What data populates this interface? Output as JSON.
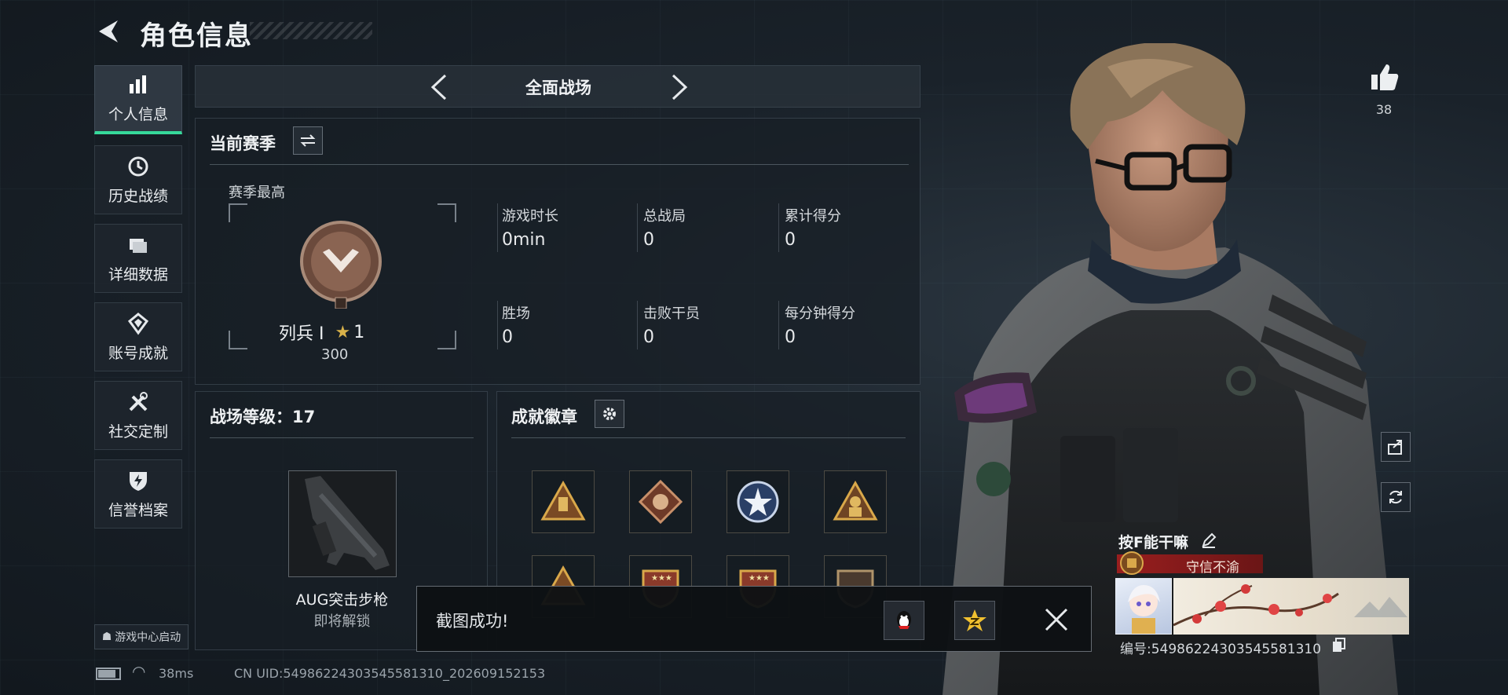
{
  "header": {
    "title": "角色信息"
  },
  "sidebar": {
    "items": [
      {
        "label": "个人信息",
        "icon": "bar-chart-icon",
        "active": true
      },
      {
        "label": "历史战绩",
        "icon": "history-clock-icon"
      },
      {
        "label": "详细数据",
        "icon": "folder-icon"
      },
      {
        "label": "账号成就",
        "icon": "medal-icon"
      },
      {
        "label": "社交定制",
        "icon": "tools-icon"
      },
      {
        "label": "信誉档案",
        "icon": "shield-bolt-icon"
      }
    ],
    "game_center": "游戏中心启动"
  },
  "mode": {
    "title": "全面战场"
  },
  "season": {
    "header": "当前赛季",
    "best_label": "赛季最高",
    "rank_name": "列兵 Ⅰ",
    "star_count": "1",
    "points": "300",
    "stats": [
      {
        "label": "游戏时长",
        "value": "0min"
      },
      {
        "label": "总战局",
        "value": "0"
      },
      {
        "label": "累计得分",
        "value": "0"
      },
      {
        "label": "胜场",
        "value": "0"
      },
      {
        "label": "击败干员",
        "value": "0"
      },
      {
        "label": "每分钟得分",
        "value": "0"
      }
    ]
  },
  "level": {
    "header": "战场等级：17",
    "weapon_name": "AUG突击步枪",
    "weapon_status": "即将解锁"
  },
  "achievements": {
    "header": "成就徽章"
  },
  "toast": {
    "message": "截图成功!"
  },
  "status_bar": {
    "ping": "38ms",
    "uid": "CN UID:5498622430354558131​0_202609152153"
  },
  "profile": {
    "likes": "38",
    "player_name": "按F能干嘛",
    "player_title": "守信不渝",
    "player_id": "编号:54986224303545581310"
  },
  "colors": {
    "accent": "#36d99a",
    "title_red": "#a01e1e",
    "gold": "#d9b24a"
  }
}
